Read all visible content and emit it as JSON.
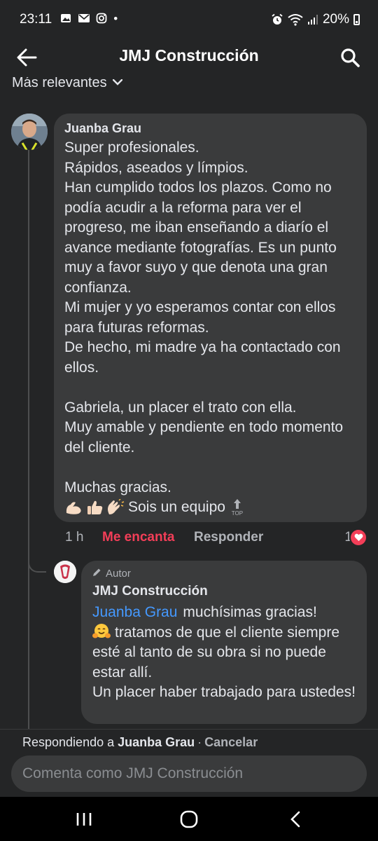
{
  "status_bar": {
    "time": "23:11",
    "notification_icons": [
      "gallery-icon",
      "mail-icon",
      "instagram-icon",
      "dot-icon"
    ],
    "system_icons": [
      "alarm-icon",
      "wifi-icon",
      "signal-icon"
    ],
    "battery": "20%"
  },
  "header": {
    "title": "JMJ Construcción",
    "back_icon": "arrow-left-icon",
    "search_icon": "search-icon"
  },
  "sort": {
    "label": "Más relevantes"
  },
  "comment": {
    "author": "Juanba Grau",
    "text": "Super profesionales.\nRápidos, aseados y límpios.\nHan cumplido todos los plazos. Como no podía acudir a la reforma para ver el progreso, me iban enseñando a diarío el avance mediante fotografías. Es un punto muy a favor suyo y que denota una gran confianza.\nMi mujer y yo esperamos contar con ellos para futuras reformas.\nDe hecho, mi madre ya ha contactado con ellos.\n\nGabriela, un placer el trato con ella.\nMuy amable y pendiente en todo momento del cliente.\n\nMuchas gracias.",
    "last_line_text": "Sois un equipo",
    "emojis": [
      "flexed-biceps-emoji",
      "thumbs-up-emoji",
      "clapping-hands-emoji",
      "top-arrow-emoji"
    ],
    "top_emoji_label": "TOP",
    "time": "1 h",
    "love_label": "Me encanta",
    "reply_label": "Responder",
    "reaction_count": "1",
    "reaction_icon": "heart-icon"
  },
  "reply": {
    "badge": "Autor",
    "badge_icon": "pencil-icon",
    "author": "JMJ Construcción",
    "mention": "Juanba Grau",
    "text_line1": "muchísimas gracias!",
    "hug_emoji": "hugging-face-emoji",
    "text_rest": "tratamos de que el cliente siempre esté al tanto de su obra si no puede estar allí.",
    "text_last": "Un placer haber trabajado para ustedes!"
  },
  "composer": {
    "replying_prefix": "Respondiendo a",
    "replying_name": "Juanba Grau",
    "separator": "·",
    "cancel_label": "Cancelar",
    "placeholder": "Comenta como JMJ Construcción"
  },
  "nav_bar": {
    "icons": [
      "recents-icon",
      "home-icon",
      "back-chevron-icon"
    ]
  },
  "colors": {
    "background": "#242526",
    "bubble": "#3a3b3c",
    "love_red": "#f33e58",
    "mention_blue": "#4599ff",
    "secondary_text": "#b0b3b8"
  }
}
